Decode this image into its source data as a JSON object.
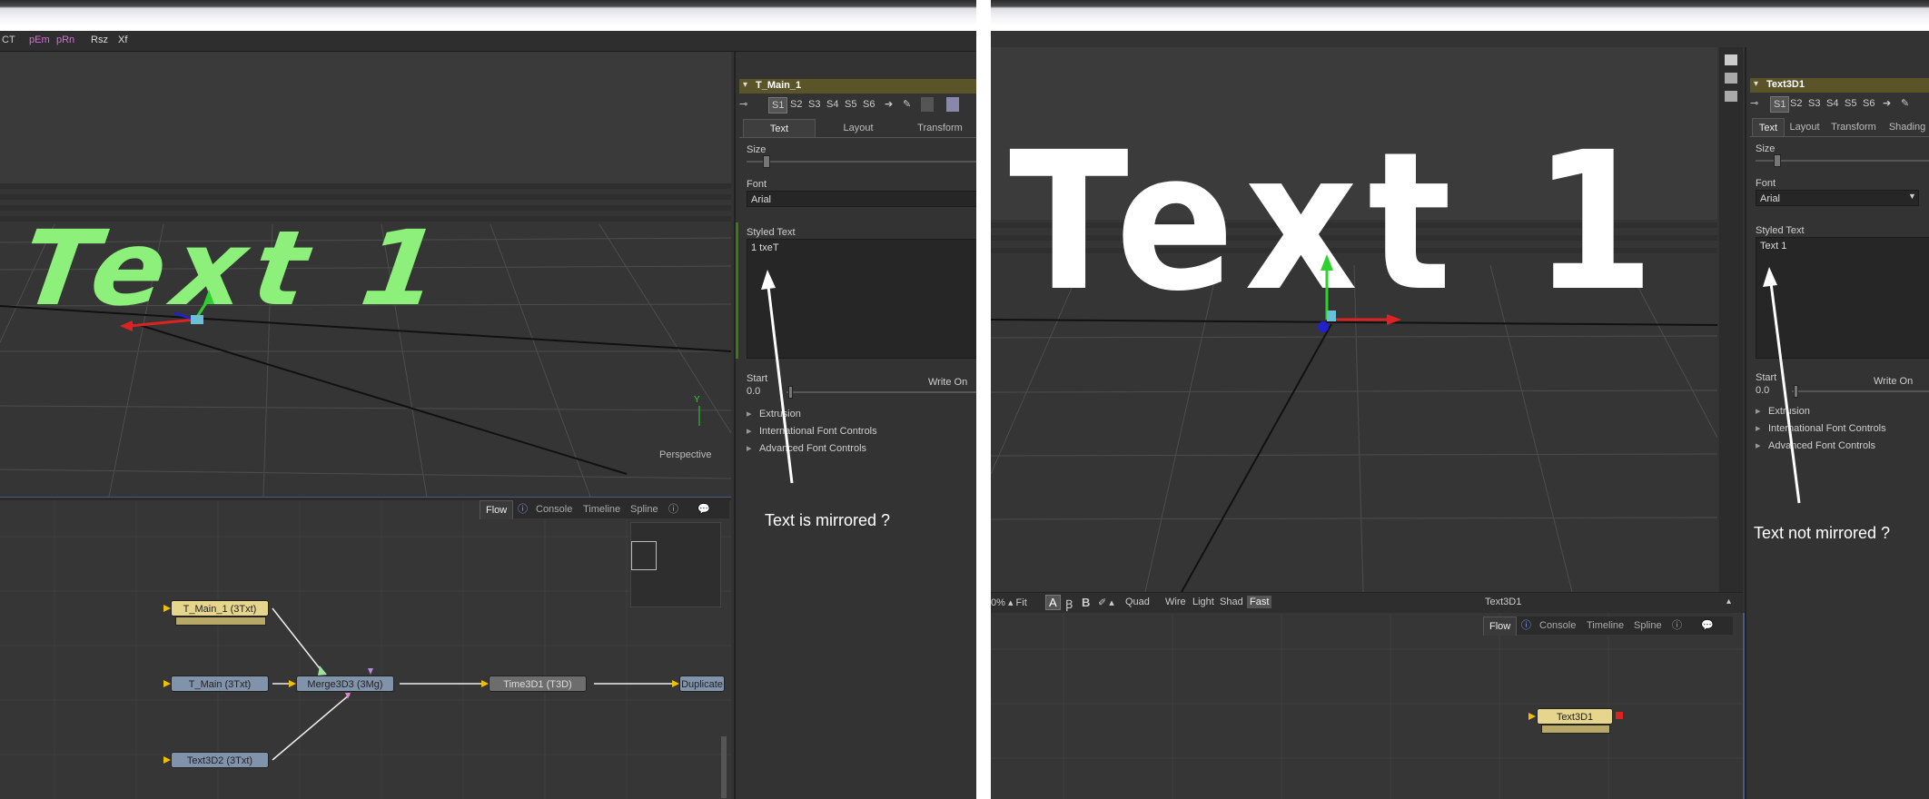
{
  "left": {
    "toolbar": [
      "CT",
      "pEm",
      "pRn",
      "Rsz",
      "Xf"
    ],
    "viewport": {
      "text3d": "Text 1",
      "axis_label": "Y",
      "view_label": "Perspective"
    },
    "inspector": {
      "node_title": "T_Main_1",
      "slots": [
        "S1",
        "S2",
        "S3",
        "S4",
        "S5",
        "S6"
      ],
      "tabs": [
        "Text",
        "Layout",
        "Transform"
      ],
      "size_label": "Size",
      "font_label": "Font",
      "font_value": "Arial",
      "styled_text_label": "Styled Text",
      "styled_text_value": "1 txeT",
      "start_label": "Start",
      "start_value": "0.0",
      "write_on_label": "Write On",
      "sections": [
        "Extrusion",
        "International Font Controls",
        "Advanced Font Controls"
      ]
    },
    "flow": {
      "tabs": [
        "Flow",
        "Console",
        "Timeline",
        "Spline"
      ],
      "nodes": [
        "T_Main_1  (3Txt)",
        "T_Main  (3Txt)",
        "Merge3D3  (3Mg)",
        "Time3D1  (T3D)",
        "Duplicate",
        "Text3D2  (3Txt)"
      ]
    },
    "annotation": "Text is mirrored ?"
  },
  "right": {
    "viewport": {
      "text3d": "Text 1",
      "status_items": [
        "0% ▴ Fit",
        "Quad",
        "Wire",
        "Light",
        "Shad",
        "Fast"
      ],
      "status_title": "Text3D1"
    },
    "inspector": {
      "node_title": "Text3D1",
      "slots": [
        "S1",
        "S2",
        "S3",
        "S4",
        "S5",
        "S6"
      ],
      "tabs": [
        "Text",
        "Layout",
        "Transform",
        "Shading"
      ],
      "size_label": "Size",
      "font_label": "Font",
      "font_value": "Arial",
      "styled_text_label": "Styled Text",
      "styled_text_value": "Text 1",
      "start_label": "Start",
      "start_value": "0.0",
      "write_on_label": "Write On",
      "sections": [
        "Extrusion",
        "International Font Controls",
        "Advanced Font Controls"
      ]
    },
    "flow": {
      "tabs": [
        "Flow",
        "Console",
        "Timeline",
        "Spline"
      ],
      "nodes": [
        "Text3D1"
      ]
    },
    "annotation": "Text not mirrored ?"
  },
  "colors": {
    "text_green": "#8df07a",
    "text_white": "#ffffff",
    "node_yellow": "#e6d58c",
    "node_blue": "#8193ab",
    "title_bar": "#5a5428"
  }
}
